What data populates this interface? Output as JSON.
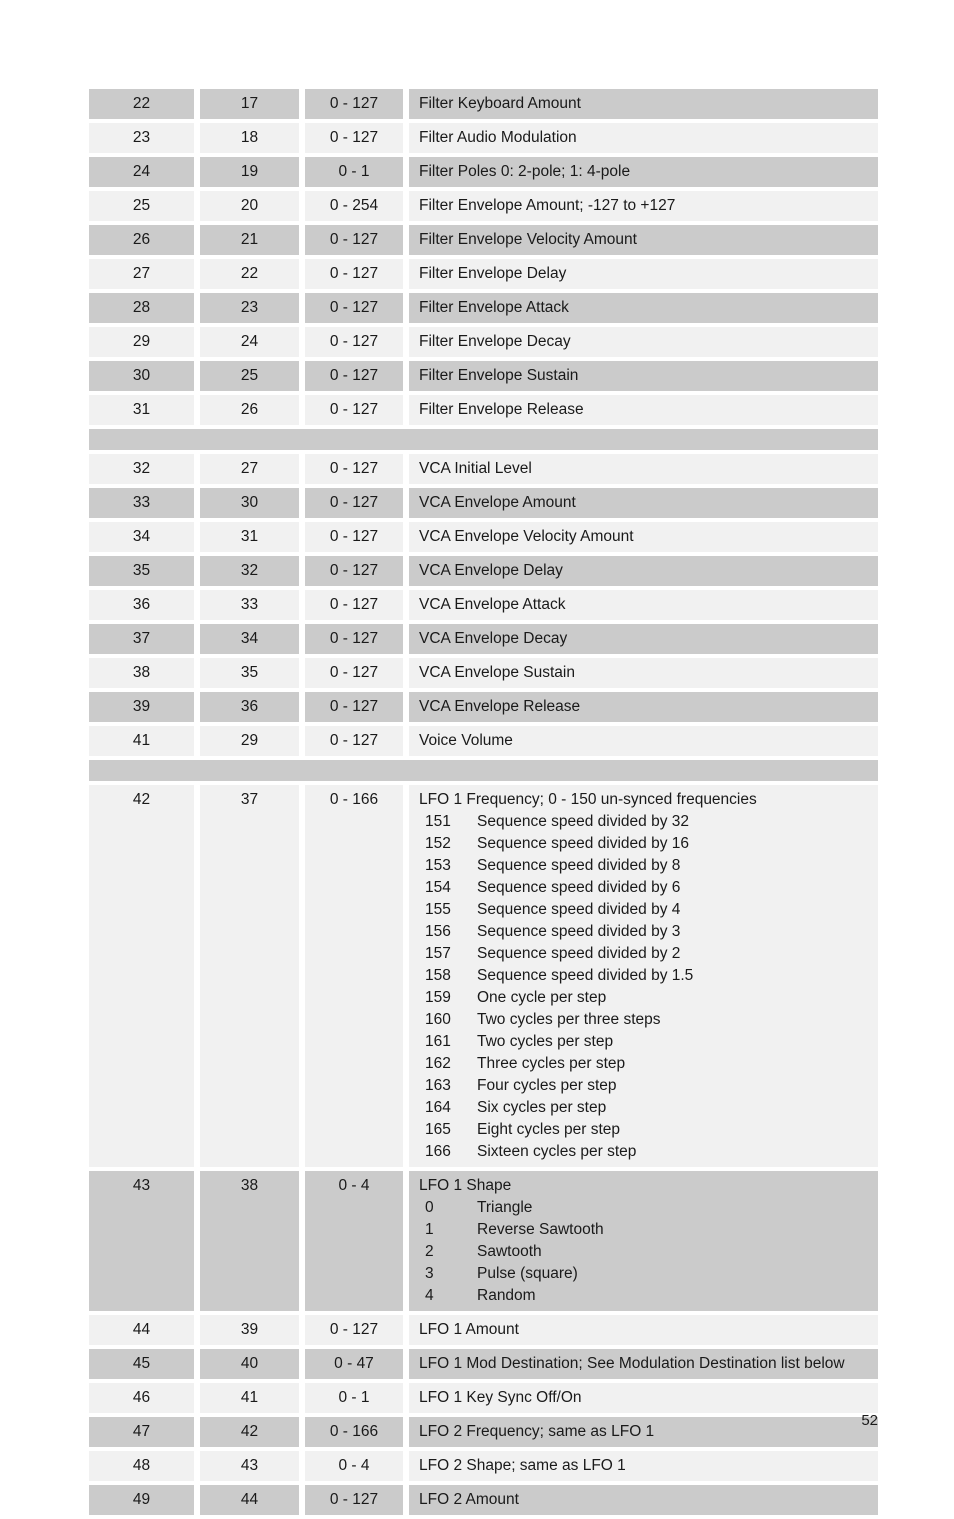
{
  "page": {
    "number": "52"
  },
  "table": {
    "rows": [
      {
        "kind": "data",
        "shade": "dark",
        "num": "22",
        "param": "17",
        "range": "0 - 127",
        "desc": "Filter Keyboard Amount"
      },
      {
        "kind": "data",
        "shade": "light",
        "num": "23",
        "param": "18",
        "range": "0 - 127",
        "desc": "Filter Audio Modulation"
      },
      {
        "kind": "data",
        "shade": "dark",
        "num": "24",
        "param": "19",
        "range": "0 - 1",
        "desc": "Filter Poles 0: 2-pole;  1: 4-pole"
      },
      {
        "kind": "data",
        "shade": "light",
        "num": "25",
        "param": "20",
        "range": "0 - 254",
        "desc": "Filter Envelope Amount;  -127 to +127"
      },
      {
        "kind": "data",
        "shade": "dark",
        "num": "26",
        "param": "21",
        "range": "0 - 127",
        "desc": "Filter Envelope Velocity Amount"
      },
      {
        "kind": "data",
        "shade": "light",
        "num": "27",
        "param": "22",
        "range": "0 - 127",
        "desc": "Filter Envelope Delay"
      },
      {
        "kind": "data",
        "shade": "dark",
        "num": "28",
        "param": "23",
        "range": "0 - 127",
        "desc": "Filter Envelope Attack"
      },
      {
        "kind": "data",
        "shade": "light",
        "num": "29",
        "param": "24",
        "range": "0 - 127",
        "desc": "Filter Envelope Decay"
      },
      {
        "kind": "data",
        "shade": "dark",
        "num": "30",
        "param": "25",
        "range": "0 - 127",
        "desc": "Filter Envelope Sustain"
      },
      {
        "kind": "data",
        "shade": "light",
        "num": "31",
        "param": "26",
        "range": "0 - 127",
        "desc": "Filter Envelope Release"
      },
      {
        "kind": "spacer"
      },
      {
        "kind": "data",
        "shade": "light",
        "num": "32",
        "param": "27",
        "range": "0 - 127",
        "desc": "VCA Initial Level"
      },
      {
        "kind": "data",
        "shade": "dark",
        "num": "33",
        "param": "30",
        "range": "0 - 127",
        "desc": "VCA Envelope Amount"
      },
      {
        "kind": "data",
        "shade": "light",
        "num": "34",
        "param": "31",
        "range": "0 - 127",
        "desc": "VCA Envelope Velocity Amount"
      },
      {
        "kind": "data",
        "shade": "dark",
        "num": "35",
        "param": "32",
        "range": "0 - 127",
        "desc": "VCA Envelope Delay"
      },
      {
        "kind": "data",
        "shade": "light",
        "num": "36",
        "param": "33",
        "range": "0 - 127",
        "desc": "VCA Envelope Attack"
      },
      {
        "kind": "data",
        "shade": "dark",
        "num": "37",
        "param": "34",
        "range": "0 - 127",
        "desc": "VCA Envelope Decay"
      },
      {
        "kind": "data",
        "shade": "light",
        "num": "38",
        "param": "35",
        "range": "0 - 127",
        "desc": "VCA Envelope Sustain"
      },
      {
        "kind": "data",
        "shade": "dark",
        "num": "39",
        "param": "36",
        "range": "0 - 127",
        "desc": "VCA Envelope Release"
      },
      {
        "kind": "data",
        "shade": "light",
        "num": "41",
        "param": "29",
        "range": "0 - 127",
        "desc": "Voice Volume"
      },
      {
        "kind": "spacer"
      },
      {
        "kind": "data",
        "shade": "light",
        "num": "42",
        "param": "37",
        "range": "0 - 166",
        "desc": "LFO 1 Frequency; 0 - 150 un-synced frequencies",
        "sublist": [
          {
            "key": "151",
            "val": "Sequence speed divided by 32"
          },
          {
            "key": "152",
            "val": "Sequence speed divided by 16"
          },
          {
            "key": "153",
            "val": "Sequence speed divided by 8"
          },
          {
            "key": "154",
            "val": "Sequence speed divided by 6"
          },
          {
            "key": "155",
            "val": "Sequence speed divided by 4"
          },
          {
            "key": "156",
            "val": "Sequence speed divided by 3"
          },
          {
            "key": "157",
            "val": "Sequence speed divided by 2"
          },
          {
            "key": "158",
            "val": "Sequence speed divided by 1.5"
          },
          {
            "key": "159",
            "val": "One cycle per step"
          },
          {
            "key": "160",
            "val": "Two cycles per three steps"
          },
          {
            "key": "161",
            "val": "Two cycles per step"
          },
          {
            "key": "162",
            "val": "Three cycles per step"
          },
          {
            "key": "163",
            "val": "Four cycles per step"
          },
          {
            "key": "164",
            "val": "Six cycles per step"
          },
          {
            "key": "165",
            "val": "Eight cycles per step"
          },
          {
            "key": "166",
            "val": "Sixteen cycles per step"
          }
        ]
      },
      {
        "kind": "data",
        "shade": "dark",
        "num": "43",
        "param": "38",
        "range": "0 - 4",
        "desc": "LFO 1 Shape",
        "sublist": [
          {
            "key": "0",
            "val": "Triangle"
          },
          {
            "key": "1",
            "val": "Reverse Sawtooth"
          },
          {
            "key": "2",
            "val": "Sawtooth"
          },
          {
            "key": "3",
            "val": "Pulse (square)"
          },
          {
            "key": "4",
            "val": "Random"
          }
        ]
      },
      {
        "kind": "data",
        "shade": "light",
        "num": "44",
        "param": "39",
        "range": "0 - 127",
        "desc": "LFO 1 Amount"
      },
      {
        "kind": "data",
        "shade": "dark",
        "num": "45",
        "param": "40",
        "range": "0 - 47",
        "desc": "LFO 1 Mod Destination; See Modulation Destination list below"
      },
      {
        "kind": "data",
        "shade": "light",
        "num": "46",
        "param": "41",
        "range": "0 - 1",
        "desc": "LFO 1 Key Sync Off/On"
      },
      {
        "kind": "data",
        "shade": "dark",
        "num": "47",
        "param": "42",
        "range": "0 - 166",
        "desc": "LFO 2 Frequency; same as LFO 1"
      },
      {
        "kind": "data",
        "shade": "light",
        "num": "48",
        "param": "43",
        "range": "0 - 4",
        "desc": "LFO 2 Shape; same as LFO 1"
      },
      {
        "kind": "data",
        "shade": "dark",
        "num": "49",
        "param": "44",
        "range": "0 - 127",
        "desc": "LFO 2 Amount"
      }
    ]
  }
}
